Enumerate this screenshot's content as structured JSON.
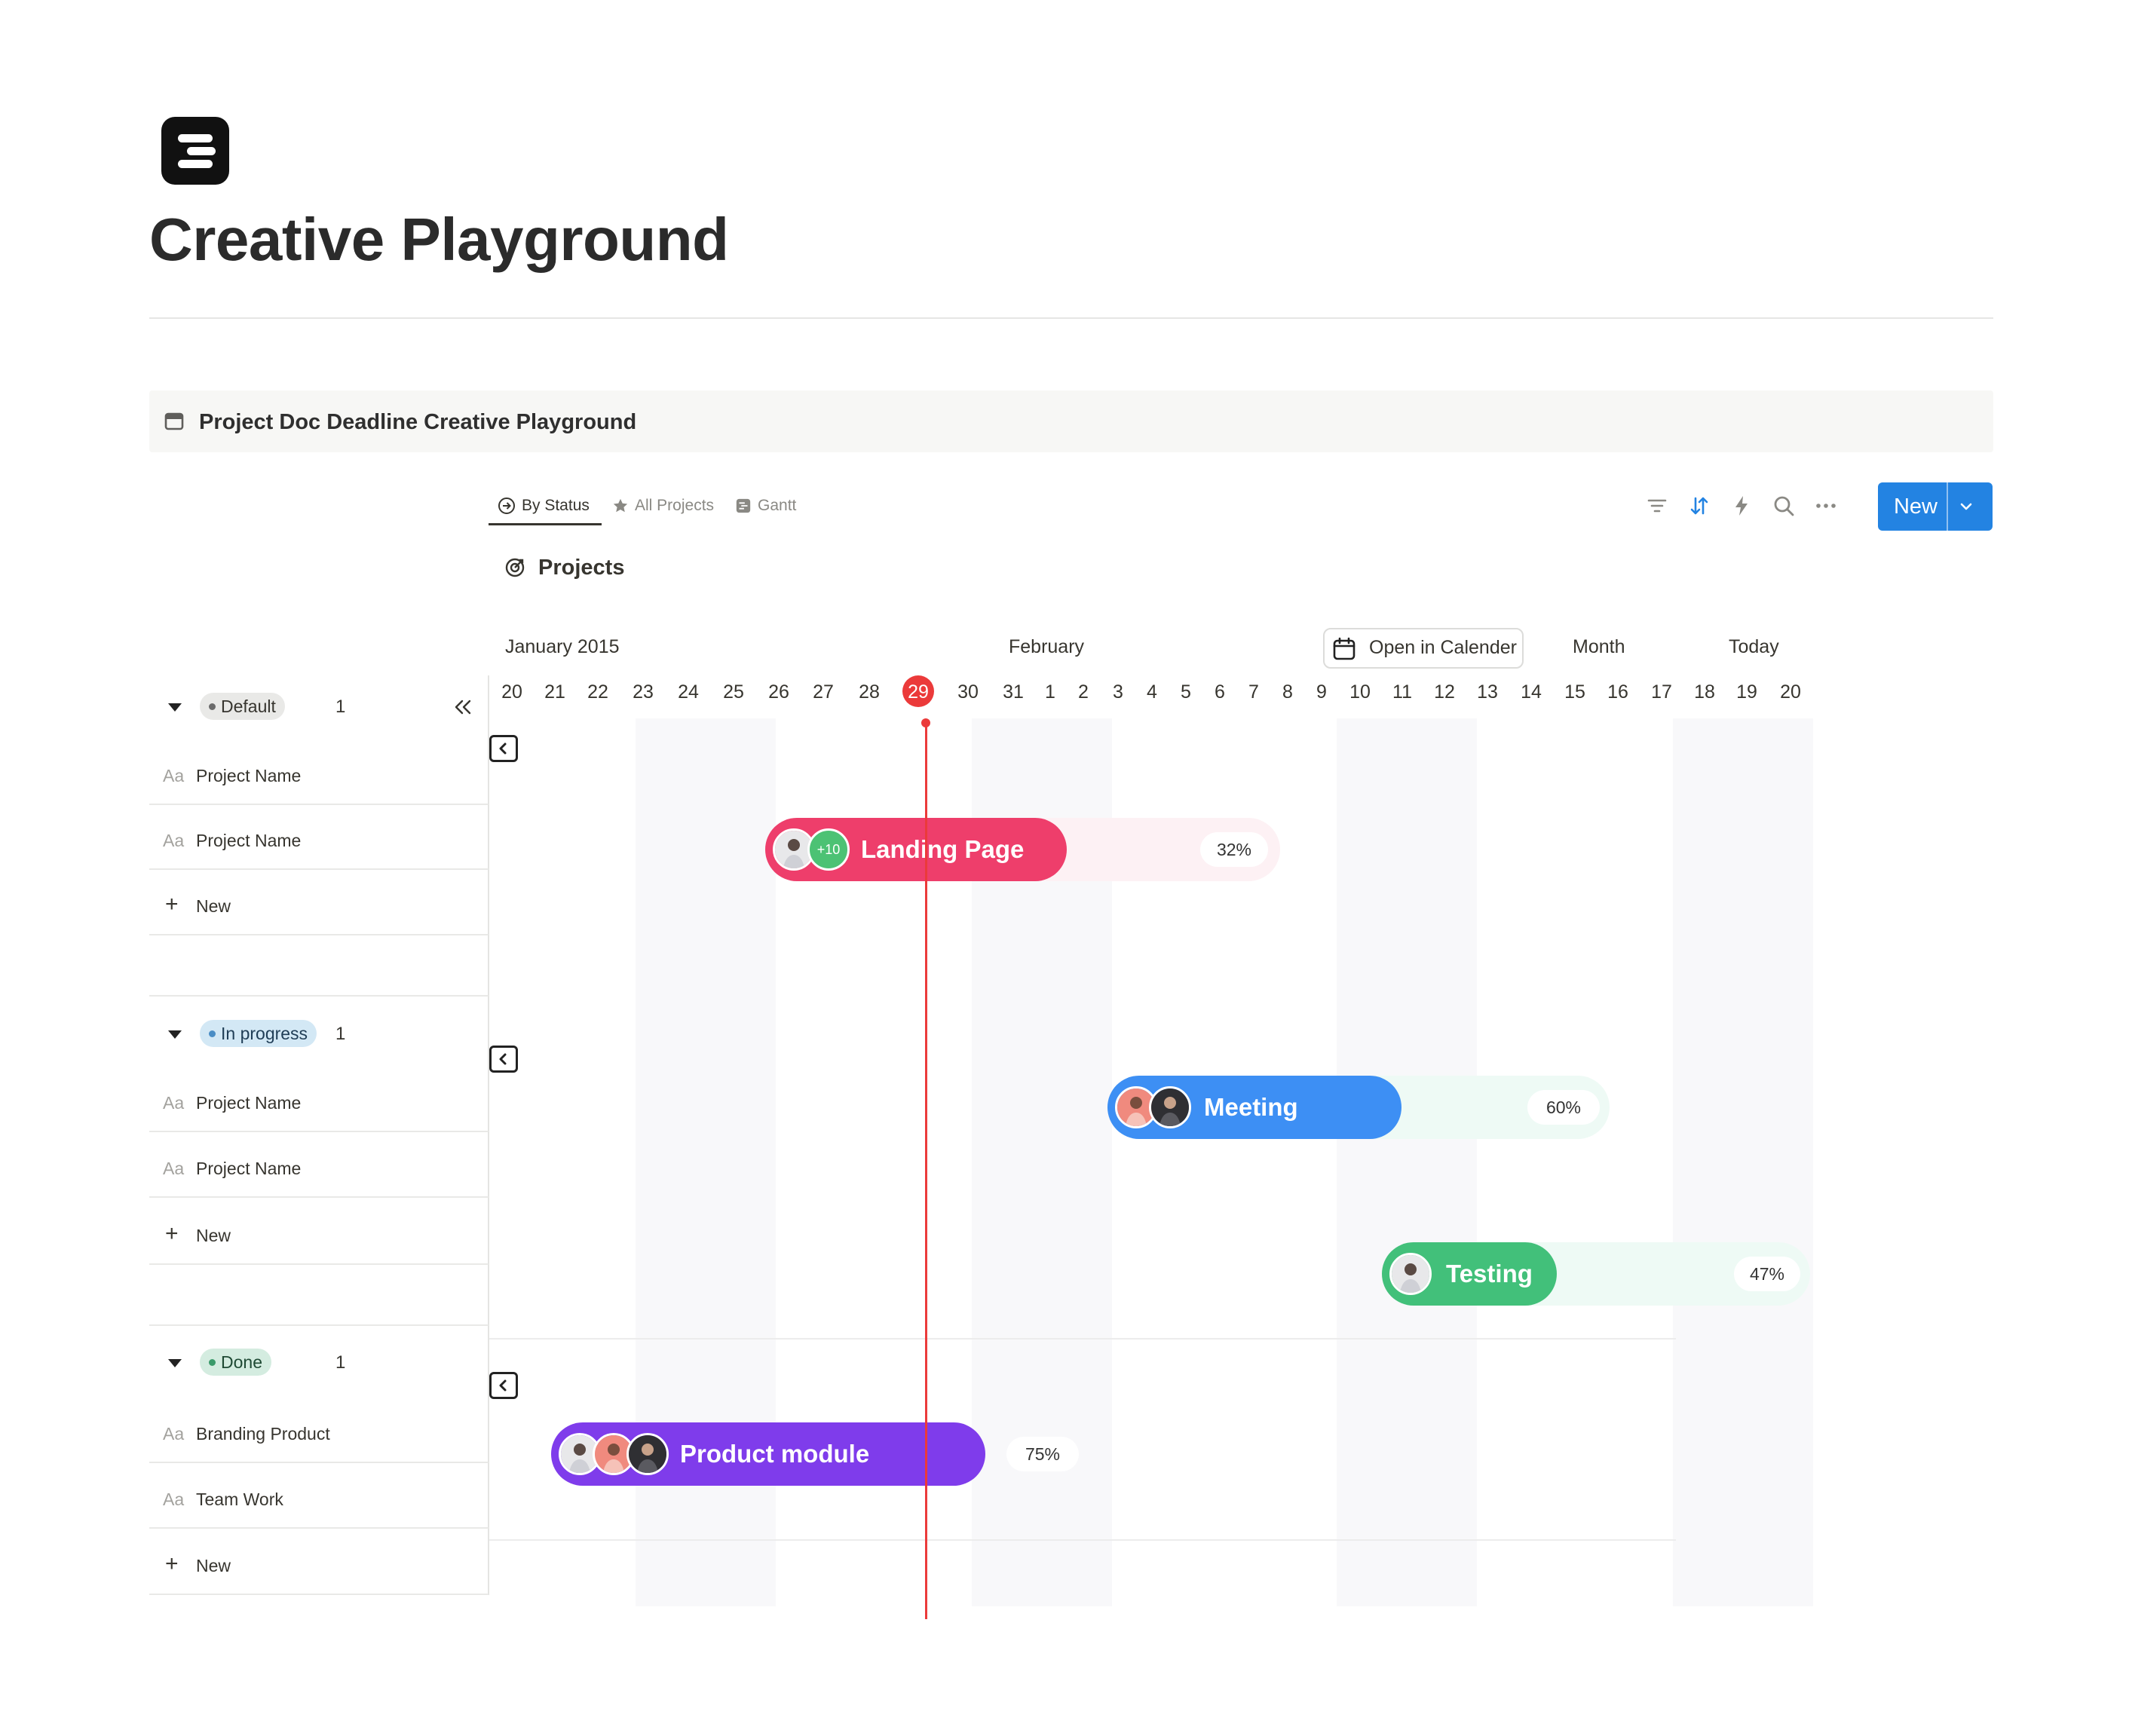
{
  "page": {
    "title": "Creative Playground"
  },
  "database": {
    "title": "Project Doc Deadline Creative Playground"
  },
  "tabs": [
    {
      "label": "By Status",
      "icon": "arrow-circle-icon",
      "active": true
    },
    {
      "label": "All Projects",
      "icon": "star-icon",
      "active": false
    },
    {
      "label": "Gantt",
      "icon": "gantt-icon",
      "active": false
    }
  ],
  "toolbar": {
    "icons": [
      "filter-icon",
      "sort-icon",
      "lightning-icon",
      "search-icon",
      "more-icon"
    ],
    "new_label": "New",
    "accent": "#2383e2"
  },
  "section": {
    "title": "Projects"
  },
  "timeline": {
    "month_left": "January 2015",
    "month_right": "February",
    "open_calendar": "Open in Calender",
    "scale": "Month",
    "today_button": "Today",
    "days": [
      "20",
      "21",
      "22",
      "23",
      "24",
      "25",
      "26",
      "27",
      "28",
      "29",
      "30",
      "31",
      "1",
      "2",
      "3",
      "4",
      "5",
      "6",
      "7",
      "8",
      "9",
      "10",
      "11",
      "12",
      "13",
      "14",
      "15",
      "16",
      "17",
      "18",
      "19",
      "20"
    ],
    "today_day": "29",
    "today_color": "#eb3a3a"
  },
  "groups": [
    {
      "name": "Default",
      "count": "1",
      "pill_bg": "#e9e9e7",
      "pill_fg": "#37352f",
      "dot": "#6b6b6b",
      "rows": [
        {
          "prefix": "Aa",
          "label": "Project Name"
        },
        {
          "prefix": "Aa",
          "label": "Project Name"
        }
      ],
      "new_label": "New"
    },
    {
      "name": "In progress",
      "count": "1",
      "pill_bg": "#d3e8f5",
      "pill_fg": "#1f3d56",
      "dot": "#4a8dc5",
      "rows": [
        {
          "prefix": "Aa",
          "label": "Project Name"
        },
        {
          "prefix": "Aa",
          "label": "Project Name"
        }
      ],
      "new_label": "New"
    },
    {
      "name": "Done",
      "count": "1",
      "pill_bg": "#d4ece0",
      "pill_fg": "#1f4a34",
      "dot": "#3a9a6a",
      "rows": [
        {
          "prefix": "Aa",
          "label": "Branding Product"
        },
        {
          "prefix": "Aa",
          "label": "Team Work"
        }
      ],
      "new_label": "New"
    }
  ],
  "tasks": [
    {
      "name": "Landing Page",
      "progress": "32%",
      "color": "#ee3e6b",
      "track": "#fdf1f4",
      "extra_assignees": "+10"
    },
    {
      "name": "Meeting",
      "progress": "60%",
      "color": "#3d8ff4",
      "track": "#eefaf5"
    },
    {
      "name": "Testing",
      "progress": "47%",
      "color": "#42c07a",
      "track": "#eefaf5"
    },
    {
      "name": "Product module",
      "progress": "75%",
      "color": "#7f3ceb",
      "track": "#ffffff"
    }
  ]
}
